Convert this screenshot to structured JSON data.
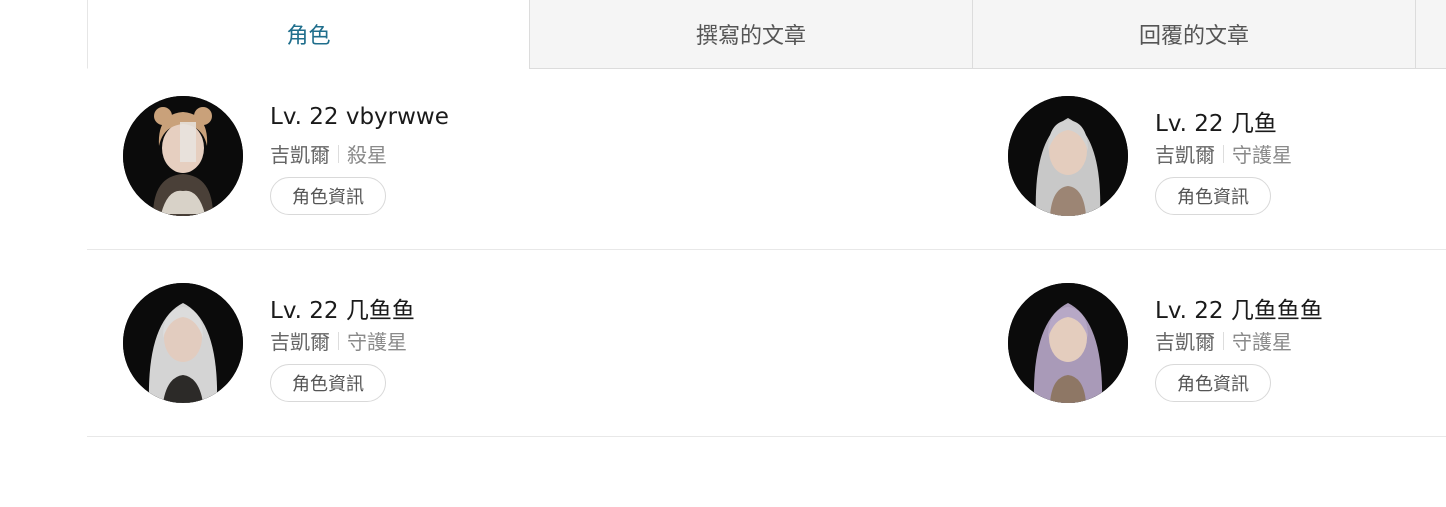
{
  "tabs": [
    {
      "label": "角色",
      "active": true
    },
    {
      "label": "撰寫的文章",
      "active": false
    },
    {
      "label": "回覆的文章",
      "active": false
    }
  ],
  "accent_color": "#1f6e8c",
  "characters": [
    {
      "name": "Lv. 22 vbyrwwe",
      "server": "吉凱爾",
      "class": "殺星",
      "button": "角色資訊",
      "hair": "#c9a17a"
    },
    {
      "name": "Lv. 22 几鱼",
      "server": "吉凱爾",
      "class": "守護星",
      "button": "角色資訊",
      "hair": "#c8c8c8"
    },
    {
      "name": "Lv. 22 几鱼鱼",
      "server": "吉凱爾",
      "class": "守護星",
      "button": "角色資訊",
      "hair": "#d4d4d4"
    },
    {
      "name": "Lv. 22 几鱼鱼鱼",
      "server": "吉凱爾",
      "class": "守護星",
      "button": "角色資訊",
      "hair": "#a99ab8"
    }
  ]
}
